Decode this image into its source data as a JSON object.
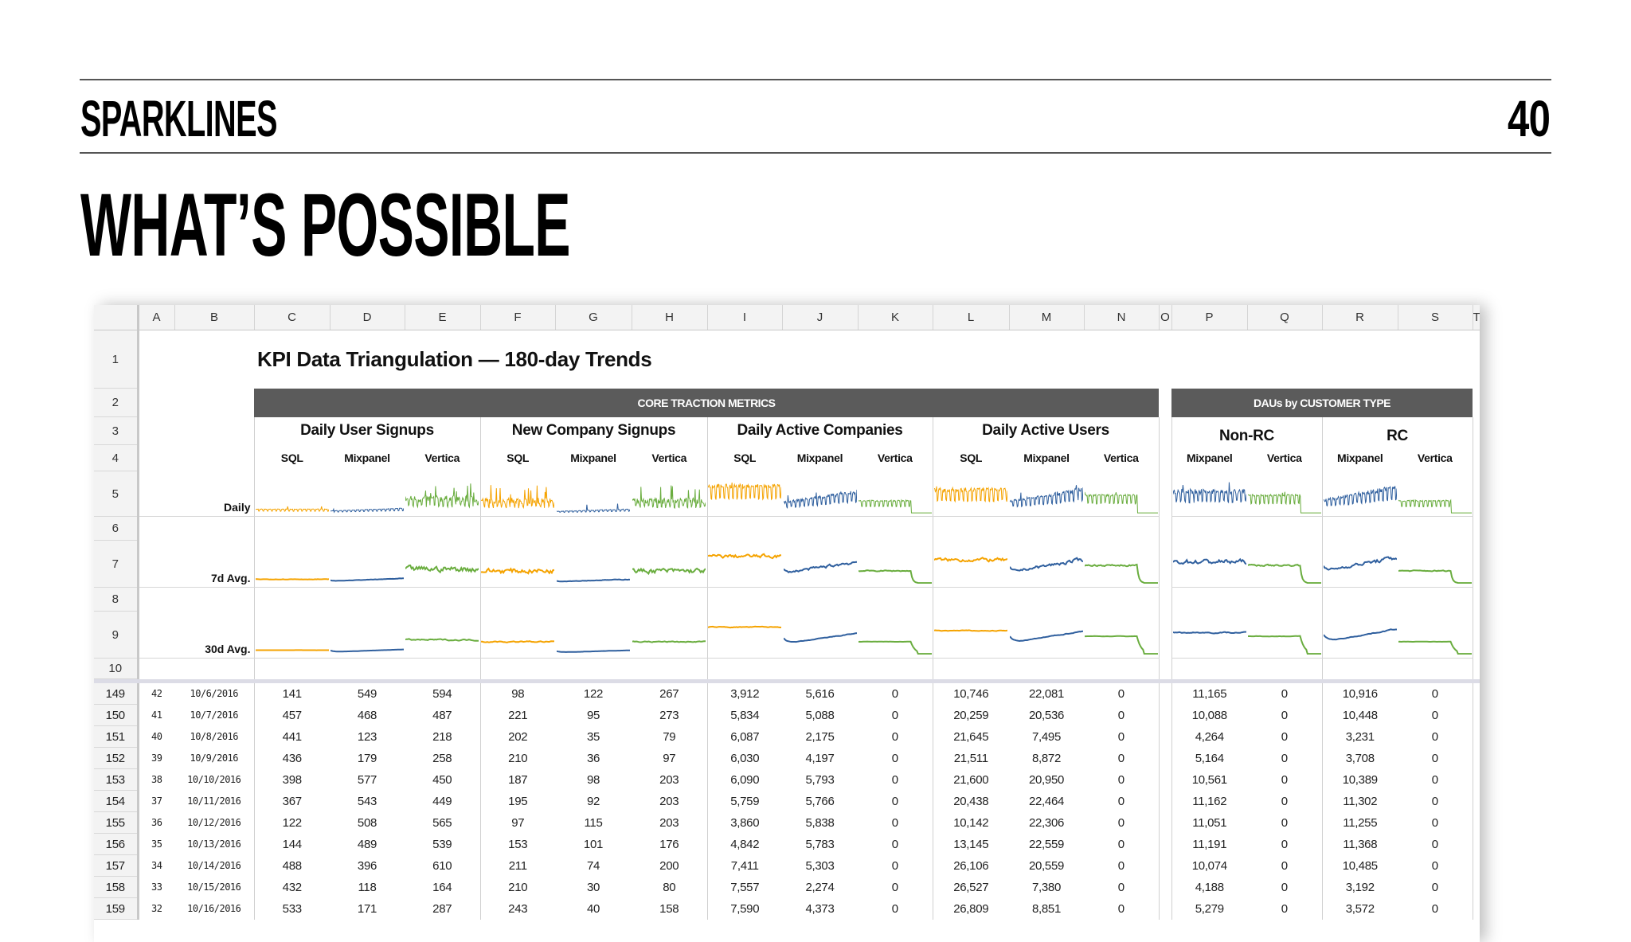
{
  "slide": {
    "section": "SPARKLINES",
    "page_number": "40",
    "title": "WHAT’S POSSIBLE"
  },
  "sheet": {
    "columns": [
      "A",
      "B",
      "C",
      "D",
      "E",
      "F",
      "G",
      "H",
      "I",
      "J",
      "K",
      "L",
      "M",
      "N",
      "O",
      "P",
      "Q",
      "R",
      "S",
      "T"
    ],
    "header_rows": [
      "1",
      "2",
      "3",
      "4",
      "5",
      "6",
      "7",
      "8",
      "9",
      "10"
    ],
    "title": "KPI Data Triangulation — 180-day Trends",
    "band_core": "CORE TRACTION METRICS",
    "band_dau": "DAUs by CUSTOMER TYPE",
    "row_labels": {
      "daily": "Daily",
      "avg7": "7d Avg.",
      "avg30": "30d Avg."
    },
    "groups": [
      {
        "title": "Daily User Signups",
        "series": [
          "SQL",
          "Mixpanel",
          "Vertica"
        ]
      },
      {
        "title": "New Company Signups",
        "series": [
          "SQL",
          "Mixpanel",
          "Vertica"
        ]
      },
      {
        "title": "Daily Active Companies",
        "series": [
          "SQL",
          "Mixpanel",
          "Vertica"
        ]
      },
      {
        "title": "Daily Active Users",
        "series": [
          "SQL",
          "Mixpanel",
          "Vertica"
        ]
      },
      {
        "title": "Non-RC",
        "series": [
          "Mixpanel",
          "Vertica"
        ]
      },
      {
        "title": "RC",
        "series": [
          "Mixpanel",
          "Vertica"
        ]
      }
    ],
    "colors": {
      "SQL": "#f5a300",
      "Mixpanel": "#2f5f9e",
      "Vertica": "#6aad3f"
    },
    "sparklines": [
      {
        "series": "SQL",
        "trend": "flat",
        "level": 0.12,
        "spiky": 0.2
      },
      {
        "series": "Mixpanel",
        "trend": "rising",
        "level": 0.12,
        "spiky": 0.2
      },
      {
        "series": "Vertica",
        "trend": "flat",
        "level": 0.4,
        "spiky": 0.9
      },
      {
        "series": "SQL",
        "trend": "flat",
        "level": 0.35,
        "spiky": 0.9
      },
      {
        "series": "Mixpanel",
        "trend": "rising",
        "level": 0.1,
        "spiky": 0.4
      },
      {
        "series": "Vertica",
        "trend": "flat",
        "level": 0.35,
        "spiky": 0.9
      },
      {
        "series": "SQL",
        "trend": "flat",
        "level": 0.75,
        "spiky": 0.3
      },
      {
        "series": "Mixpanel",
        "trend": "rising",
        "level": 0.5,
        "spiky": 0.4
      },
      {
        "series": "Vertica",
        "trend": "drop",
        "level": 0.35,
        "spiky": 0.2
      },
      {
        "series": "SQL",
        "trend": "flat",
        "level": 0.65,
        "spiky": 0.35
      },
      {
        "series": "Mixpanel",
        "trend": "rising",
        "level": 0.55,
        "spiky": 0.4
      },
      {
        "series": "Vertica",
        "trend": "drop",
        "level": 0.5,
        "spiky": 0.2
      },
      {
        "series": "Mixpanel",
        "trend": "flat",
        "level": 0.6,
        "spiky": 0.5
      },
      {
        "series": "Vertica",
        "trend": "drop",
        "level": 0.5,
        "spiky": 0.2
      },
      {
        "series": "Mixpanel",
        "trend": "rising",
        "level": 0.6,
        "spiky": 0.4
      },
      {
        "series": "Vertica",
        "trend": "drop",
        "level": 0.35,
        "spiky": 0.2
      }
    ],
    "rows": [
      {
        "n": "149",
        "a": "42",
        "b": "10/6/2016",
        "v": [
          "141",
          "549",
          "594",
          "98",
          "122",
          "267",
          "3,912",
          "5,616",
          "0",
          "10,746",
          "22,081",
          "0"
        ],
        "d": [
          "11,165",
          "0",
          "10,916",
          "0"
        ]
      },
      {
        "n": "150",
        "a": "41",
        "b": "10/7/2016",
        "v": [
          "457",
          "468",
          "487",
          "221",
          "95",
          "273",
          "5,834",
          "5,088",
          "0",
          "20,259",
          "20,536",
          "0"
        ],
        "d": [
          "10,088",
          "0",
          "10,448",
          "0"
        ]
      },
      {
        "n": "151",
        "a": "40",
        "b": "10/8/2016",
        "v": [
          "441",
          "123",
          "218",
          "202",
          "35",
          "79",
          "6,087",
          "2,175",
          "0",
          "21,645",
          "7,495",
          "0"
        ],
        "d": [
          "4,264",
          "0",
          "3,231",
          "0"
        ]
      },
      {
        "n": "152",
        "a": "39",
        "b": "10/9/2016",
        "v": [
          "436",
          "179",
          "258",
          "210",
          "36",
          "97",
          "6,030",
          "4,197",
          "0",
          "21,511",
          "8,872",
          "0"
        ],
        "d": [
          "5,164",
          "0",
          "3,708",
          "0"
        ]
      },
      {
        "n": "153",
        "a": "38",
        "b": "10/10/2016",
        "v": [
          "398",
          "577",
          "450",
          "187",
          "98",
          "203",
          "6,090",
          "5,793",
          "0",
          "21,600",
          "20,950",
          "0"
        ],
        "d": [
          "10,561",
          "0",
          "10,389",
          "0"
        ]
      },
      {
        "n": "154",
        "a": "37",
        "b": "10/11/2016",
        "v": [
          "367",
          "543",
          "449",
          "195",
          "92",
          "203",
          "5,759",
          "5,766",
          "0",
          "20,438",
          "22,464",
          "0"
        ],
        "d": [
          "11,162",
          "0",
          "11,302",
          "0"
        ]
      },
      {
        "n": "155",
        "a": "36",
        "b": "10/12/2016",
        "v": [
          "122",
          "508",
          "565",
          "97",
          "115",
          "203",
          "3,860",
          "5,838",
          "0",
          "10,142",
          "22,306",
          "0"
        ],
        "d": [
          "11,051",
          "0",
          "11,255",
          "0"
        ]
      },
      {
        "n": "156",
        "a": "35",
        "b": "10/13/2016",
        "v": [
          "144",
          "489",
          "539",
          "153",
          "101",
          "176",
          "4,842",
          "5,783",
          "0",
          "13,145",
          "22,559",
          "0"
        ],
        "d": [
          "11,191",
          "0",
          "11,368",
          "0"
        ]
      },
      {
        "n": "157",
        "a": "34",
        "b": "10/14/2016",
        "v": [
          "488",
          "396",
          "610",
          "211",
          "74",
          "200",
          "7,411",
          "5,303",
          "0",
          "26,106",
          "20,559",
          "0"
        ],
        "d": [
          "10,074",
          "0",
          "10,485",
          "0"
        ]
      },
      {
        "n": "158",
        "a": "33",
        "b": "10/15/2016",
        "v": [
          "432",
          "118",
          "164",
          "210",
          "30",
          "80",
          "7,557",
          "2,274",
          "0",
          "26,527",
          "7,380",
          "0"
        ],
        "d": [
          "4,188",
          "0",
          "3,192",
          "0"
        ]
      },
      {
        "n": "159",
        "a": "32",
        "b": "10/16/2016",
        "v": [
          "533",
          "171",
          "287",
          "243",
          "40",
          "158",
          "7,590",
          "4,373",
          "0",
          "26,809",
          "8,851",
          "0"
        ],
        "d": [
          "5,279",
          "0",
          "3,572",
          "0"
        ]
      }
    ]
  }
}
